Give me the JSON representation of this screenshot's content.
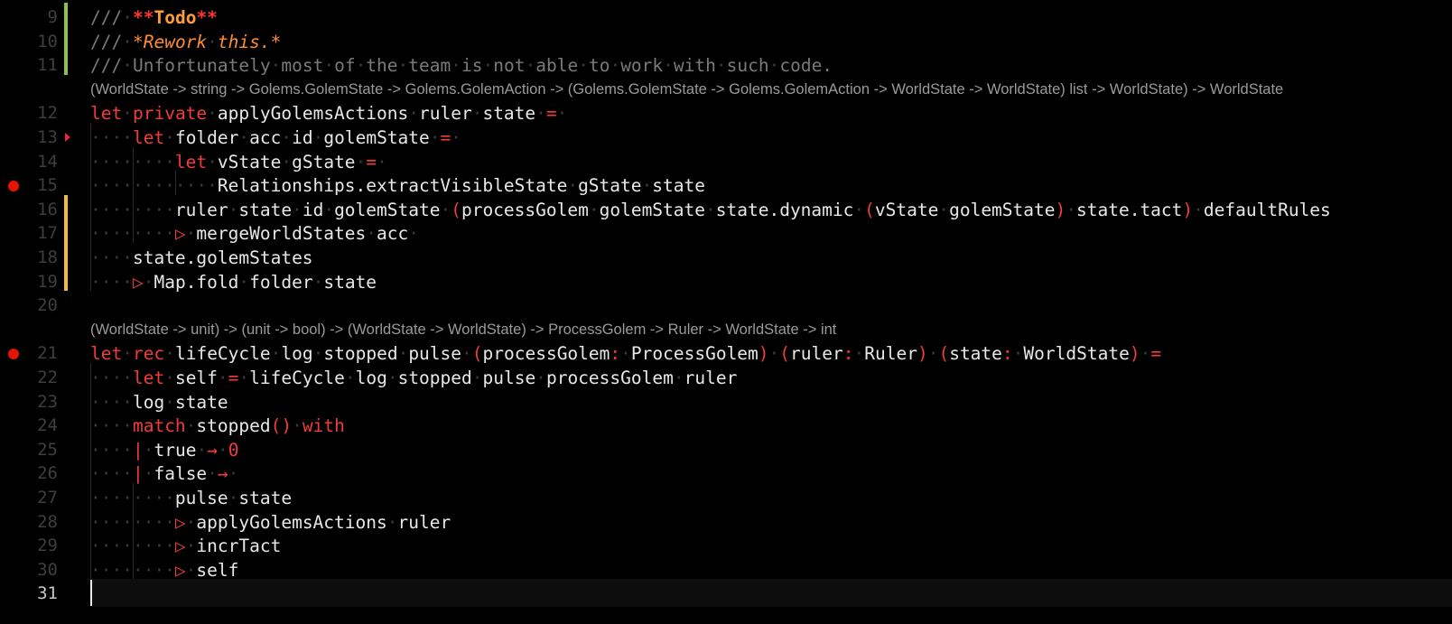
{
  "editor": {
    "language": "fsharp",
    "current_line": 31,
    "colors": {
      "keyword": "#f23b3b",
      "comment": "#7a7a7a",
      "comment_bold": "#ff9d3a",
      "comment_italic": "#ff8c32",
      "breakpoint": "#e51400",
      "diff_added": "#8bc34a",
      "diff_modified": "#f5b93c",
      "fold_marker": "#e8214a",
      "type_hint": "#9a9a9a"
    },
    "breakpoints": [
      15,
      21
    ],
    "diff_markers": [
      {
        "from": 9,
        "to": 11,
        "kind": "added"
      },
      {
        "from": 16,
        "to": 19,
        "kind": "modified"
      }
    ],
    "type_hints": [
      {
        "before_line": 12,
        "text": "(WorldState -> string -> Golems.GolemState -> Golems.GolemAction -> (Golems.GolemState -> Golems.GolemAction -> WorldState -> WorldState) list -> WorldState) -> WorldState"
      },
      {
        "before_line": 21,
        "text": "(WorldState -> unit) -> (unit -> bool) -> (WorldState -> WorldState) -> ProcessGolem -> Ruler -> WorldState -> int"
      }
    ],
    "lines": [
      {
        "n": 9,
        "indent": 0,
        "text": "/// **Todo**"
      },
      {
        "n": 10,
        "indent": 0,
        "text": "/// *Rework this.*"
      },
      {
        "n": 11,
        "indent": 0,
        "text": "/// Unfortunately most of the team is not able to work with such code."
      },
      {
        "n": 12,
        "indent": 0,
        "text": "let private applyGolemsActions ruler state = "
      },
      {
        "n": 13,
        "indent": 4,
        "text": "let folder acc id golemState = "
      },
      {
        "n": 14,
        "indent": 8,
        "text": "let vState gState = "
      },
      {
        "n": 15,
        "indent": 12,
        "text": "Relationships.extractVisibleState gState state"
      },
      {
        "n": 16,
        "indent": 8,
        "text": "ruler state id golemState (processGolem golemState state.dynamic (vState golemState) state.tact) defaultRules"
      },
      {
        "n": 17,
        "indent": 8,
        "text": "|> mergeWorldStates acc "
      },
      {
        "n": 18,
        "indent": 4,
        "text": "state.golemStates"
      },
      {
        "n": 19,
        "indent": 4,
        "text": "|> Map.fold folder state"
      },
      {
        "n": 20,
        "indent": 0,
        "text": ""
      },
      {
        "n": 21,
        "indent": 0,
        "text": "let rec lifeCycle log stopped pulse (processGolem: ProcessGolem) (ruler: Ruler) (state: WorldState) ="
      },
      {
        "n": 22,
        "indent": 4,
        "text": "let self = lifeCycle log stopped pulse processGolem ruler"
      },
      {
        "n": 23,
        "indent": 4,
        "text": "log state"
      },
      {
        "n": 24,
        "indent": 4,
        "text": "match stopped() with"
      },
      {
        "n": 25,
        "indent": 4,
        "text": "| true -> 0"
      },
      {
        "n": 26,
        "indent": 4,
        "text": "| false -> "
      },
      {
        "n": 27,
        "indent": 8,
        "text": "pulse state"
      },
      {
        "n": 28,
        "indent": 8,
        "text": "|> applyGolemsActions ruler"
      },
      {
        "n": 29,
        "indent": 8,
        "text": "|> incrTact"
      },
      {
        "n": 30,
        "indent": 8,
        "text": "|> self"
      },
      {
        "n": 31,
        "indent": 0,
        "text": ""
      }
    ]
  }
}
